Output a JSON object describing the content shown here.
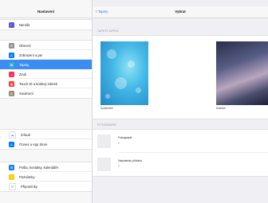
{
  "status": {
    "carrier": "•••○○ Vodafone CZ  ",
    "time": "9:41",
    "battery": "100 %"
  },
  "sidebar": {
    "title": "Nastavení",
    "groups": [
      [
        {
          "label": "Nerušit",
          "icon": "moon-icon",
          "color": "#5856d6",
          "glyph": "☾"
        }
      ],
      [
        {
          "label": "Obecné",
          "icon": "gear-icon",
          "color": "#8e8e93",
          "glyph": "⚙"
        },
        {
          "label": "Zobrazení a jas",
          "icon": "brightness-icon",
          "color": "#007aff",
          "glyph": "A"
        },
        {
          "label": "Tapety",
          "icon": "wallpaper-icon",
          "color": "#34aadc",
          "glyph": "✿",
          "selected": true
        },
        {
          "label": "Zvuk",
          "icon": "sound-icon",
          "color": "#ff2d55",
          "glyph": "♪"
        },
        {
          "label": "Touch ID a kódový zámek",
          "icon": "fingerprint-icon",
          "color": "#ff3b30",
          "glyph": "◉"
        },
        {
          "label": "Soukromí",
          "icon": "hand-icon",
          "color": "#8e8e93",
          "glyph": "✋"
        }
      ],
      [
        {
          "label": "iCloud",
          "icon": "cloud-icon",
          "color": "#ffffff",
          "glyph": "☁",
          "fg": "#3a8df3"
        },
        {
          "label": "iTunes a App Store",
          "icon": "appstore-icon",
          "color": "#007aff",
          "glyph": "A"
        }
      ],
      [
        {
          "label": "Pošta, kontakty, kalendáře",
          "icon": "mail-icon",
          "color": "#1e7cf2",
          "glyph": "✉"
        },
        {
          "label": "Poznámky",
          "icon": "notes-icon",
          "color": "#ffcc00",
          "glyph": "≡"
        },
        {
          "label": "Připomínky",
          "icon": "reminders-icon",
          "color": "#ffffff",
          "glyph": "☰",
          "fg": "#999"
        }
      ]
    ]
  },
  "main": {
    "back_label": "Tapety",
    "title": "Vybrat",
    "apple_section": "TAPETY APPLE",
    "dynamic_label": "Dynamické",
    "still_label": "Klasické",
    "photos_section": "FOTOGRAFIE",
    "albums": [
      {
        "title": "Fotoaparát",
        "count": "0"
      },
      {
        "title": "Naposledy přidáno",
        "count": "0"
      }
    ]
  }
}
